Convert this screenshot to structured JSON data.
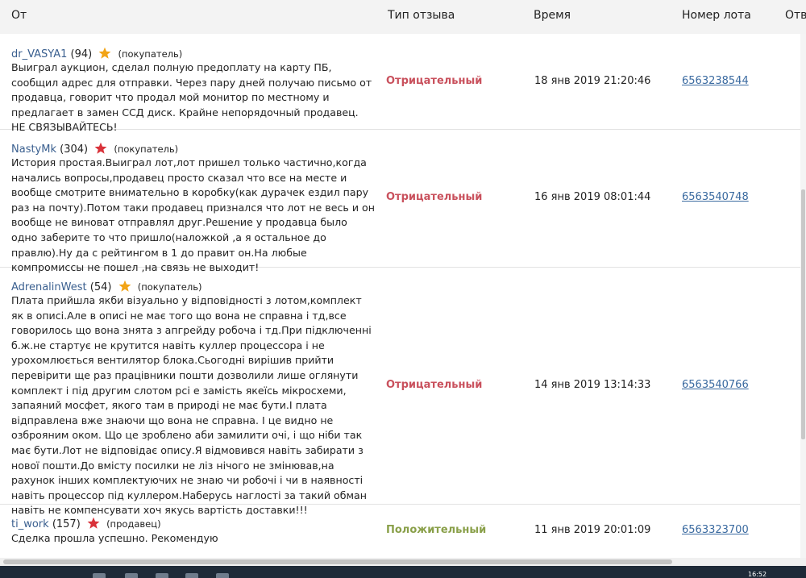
{
  "columns": {
    "from": "От",
    "type": "Тип отзыва",
    "time": "Время",
    "lot": "Номер лота",
    "answer": "Отв"
  },
  "colors": {
    "negative": "#c9515d",
    "positive": "#8aa04a",
    "link": "#3a6aa0",
    "star_orange": "#f2a416",
    "star_red": "#d9323a"
  },
  "reviews": [
    {
      "user": "dr_VASYA1",
      "rating": "(94)",
      "star_icon": "orange-star-icon",
      "role": "(покупатель)",
      "text": "Выиграл аукцион, сделал полную предоплату на карту ПБ, сообщил адрес для отправки. Через пару дней получаю письмо от продавца, говорит что продал мой монитор по местному и предлагает в замен ССД диск. Крайне непорядочный продавец. НЕ СВЯЗЫВАЙТЕСЬ!",
      "type": "Отрицательный",
      "time": "18 янв 2019 21:20:46",
      "lot": "6563238544"
    },
    {
      "user": "NastyMk",
      "rating": "(304)",
      "star_icon": "red-star-icon",
      "role": "(покупатель)",
      "text": "История простая.Выиграл лот,лот пришел только частично,когда начались вопросы,продавец просто сказал что все на месте и вообще смотрите внимательно в коробку(как дурачек ездил пару раз на почту).Потом таки продавец признался что лот не весь и он вообще не виноват отправлял друг.Решение у продавца было одно заберите то что пришло(наложкой ,а я остальное до правлю).Ну да с рейтингом в 1 до правит он.На любые компромиссы не пошел ,на связь не выходит!",
      "type": "Отрицательный",
      "time": "16 янв 2019 08:01:44",
      "lot": "6563540748"
    },
    {
      "user": "AdrenalinWest",
      "rating": "(54)",
      "star_icon": "orange-star-icon",
      "role": "(покупатель)",
      "text": "Плата прийшла якби візуально у відповідності з лотом,комплект як в описі.Але в описі не має того що вона не справна і тд,все говорилось що вона знята з апгрейду робоча і тд.При підключенні б.ж.не стартує не крутится навіть куллер процессора і не урохомлюється вентилятор блока.Сьогодні вирішив прийти перевірити ще раз працівники пошти дозволили лише оглянути комплект і під другим слотом pci е замість якеїсь мікросхеми, запаяний мосфет, якого там в природі не має бути.І плата відправлена вже знаючи що вона не справна. І це видно не озброяним оком. Що це зроблено аби замилити очі, і що ніби так має бути.Лот не відповідає опису.Я відмовився навіть забирати з нової пошти.До вмісту посилки не ліз нічого не змінював,на рахунок інших комплектуючих не знаю чи робочі і чи в наявності навіть процессор під куллером.Наберусь наглості за такий обман навіть не компенсувати хоч якусь вартість доставки!!!",
      "type": "Отрицательный",
      "time": "14 янв 2019 13:14:33",
      "lot": "6563540766"
    },
    {
      "user": "ti_work",
      "rating": "(157)",
      "star_icon": "red-star-icon",
      "role": "(продавец)",
      "text": "Сделка прошла успешно. Рекомендую",
      "type": "Положительный",
      "time": "11 янв 2019 20:01:09",
      "lot": "6563323700"
    }
  ],
  "taskbar": {
    "clock": "16:52"
  }
}
